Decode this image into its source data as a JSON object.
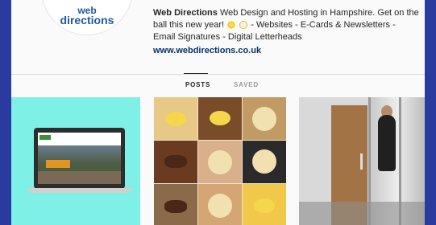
{
  "profile": {
    "logo_line1": "web",
    "logo_line2": "directions",
    "name": "Web Directions",
    "bio_text": "Web Design and Hosting in Hampshire. Get on the ball this new year!",
    "bio_rest": "- Websites - E-Cards & Newsletters - Email Signatures - Digital Letterheads",
    "website": "www.webdirections.co.uk"
  },
  "tabs": {
    "posts": "POSTS",
    "saved": "SAVED"
  },
  "colors": {
    "frame": "#2b3a9f",
    "text": "#262626",
    "link": "#003569"
  }
}
